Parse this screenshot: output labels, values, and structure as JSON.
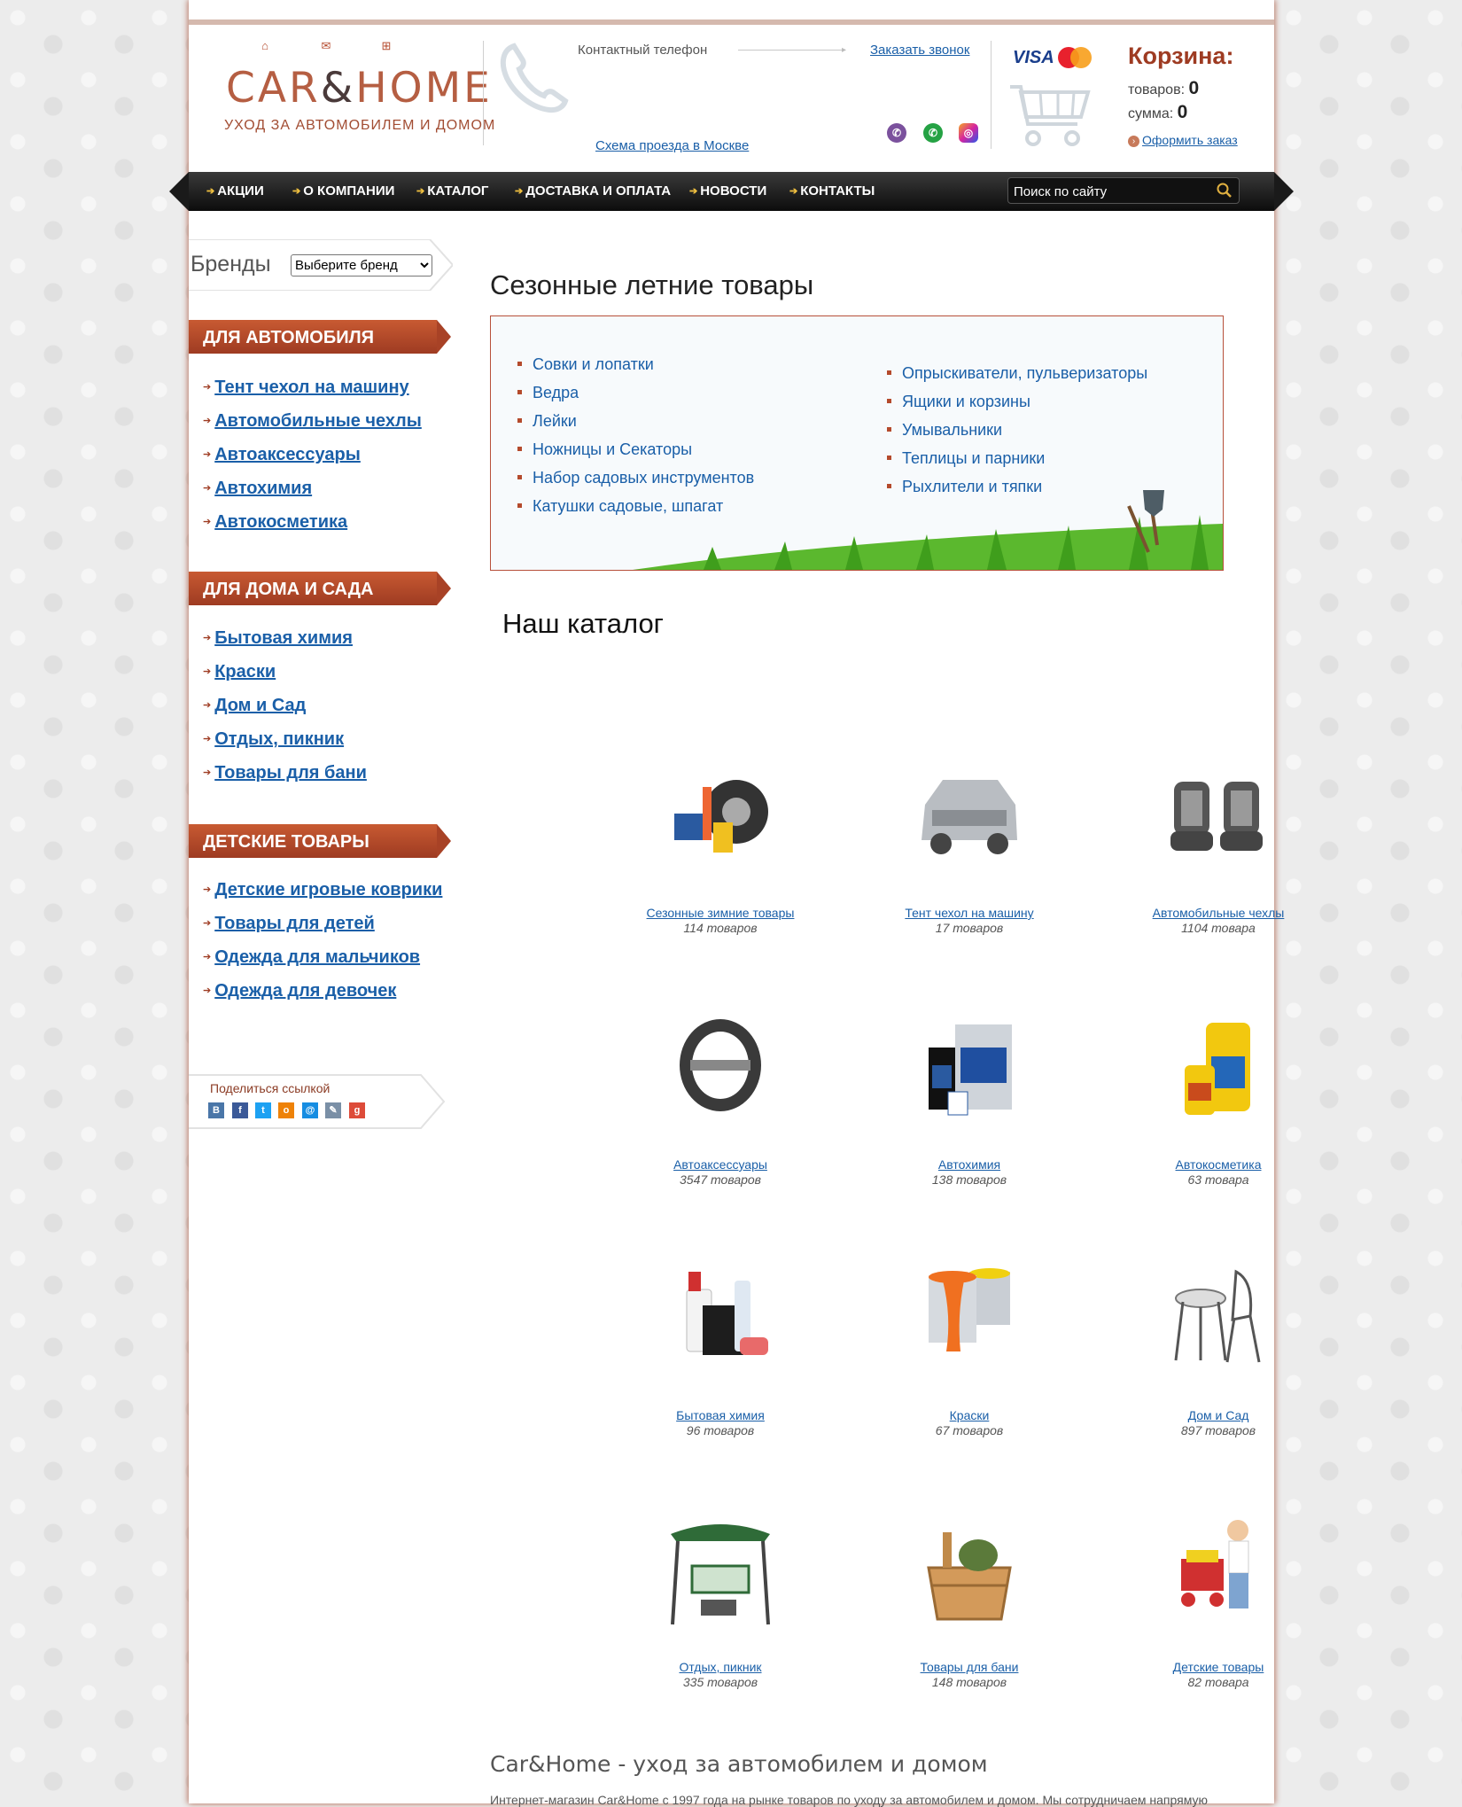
{
  "header": {
    "logo": {
      "part1": "CAR",
      "amp": "&",
      "part2": "HOME",
      "tagline": "УХОД ЗА АВТОМОБИЛЕМ И ДОМОМ"
    },
    "contact_label": "Контактный телефон",
    "callback_link": "Заказать звонок",
    "scheme_link": "Схема проезда в Москве",
    "cards": {
      "visa": "VISA"
    },
    "cart": {
      "title": "Корзина:",
      "items_label": "товаров:",
      "items_value": "0",
      "sum_label": "сумма:",
      "sum_value": "0",
      "order_link": "Оформить заказ"
    }
  },
  "nav": {
    "items": [
      "АКЦИИ",
      "О КОМПАНИИ",
      "КАТАЛОГ",
      "ДОСТАВКА И ОПЛАТА",
      "НОВОСТИ",
      "КОНТАКТЫ"
    ],
    "search_placeholder": "Поиск по сайту"
  },
  "sidebar": {
    "brands_label": "Бренды",
    "brands_select": "Выберите бренд",
    "sections": [
      {
        "title": "ДЛЯ АВТОМОБИЛЯ",
        "items": [
          "Тент чехол на машину",
          "Автомобильные чехлы",
          "Автоаксессуары",
          "Автохимия",
          "Автокосметика"
        ]
      },
      {
        "title": "ДЛЯ ДОМА И САДА",
        "items": [
          "Бытовая химия",
          "Краски",
          "Дом и Сад",
          "Отдых, пикник",
          "Товары для бани"
        ]
      },
      {
        "title": "ДЕТСКИЕ ТОВАРЫ",
        "items": [
          "Детские игровые коврики",
          "Товары для детей",
          "Одежда для мальчиков",
          "Одежда для девочек"
        ]
      }
    ],
    "share_label": "Поделиться ссылкой"
  },
  "seasonal": {
    "title": "Сезонные летние товары",
    "left": [
      "Совки и лопатки",
      "Ведра",
      "Лейки",
      "Ножницы и Секаторы",
      "Набор садовых инструментов",
      "Катушки садовые, шпагат"
    ],
    "right": [
      "Опрыскиватели, пульверизаторы",
      "Ящики и корзины",
      "Умывальники",
      "Теплицы и парники",
      "Рыхлители и тяпки"
    ]
  },
  "catalog": {
    "title": "Наш каталог",
    "items": [
      {
        "name": "Сезонные зимние товары",
        "count": "114 товаров"
      },
      {
        "name": "Тент чехол на машину",
        "count": "17 товаров"
      },
      {
        "name": "Автомобильные чехлы",
        "count": "1104 товара"
      },
      {
        "name": "Автоаксессуары",
        "count": "3547 товаров"
      },
      {
        "name": "Автохимия",
        "count": "138 товаров"
      },
      {
        "name": "Автокосметика",
        "count": "63 товара"
      },
      {
        "name": "Бытовая химия",
        "count": "96 товаров"
      },
      {
        "name": "Краски",
        "count": "67 товаров"
      },
      {
        "name": "Дом и Сад",
        "count": "897 товаров"
      },
      {
        "name": "Отдых, пикник",
        "count": "335 товаров"
      },
      {
        "name": "Товары для бани",
        "count": "148 товаров"
      },
      {
        "name": "Детские товары",
        "count": "82 товара"
      }
    ]
  },
  "footer": {
    "title": "Car&Home - уход за автомобилем и домом",
    "text": "Интернет-магазин Car&Home с 1997 года на рынке товаров по уходу за автомобилем и домом. Мы сотрудничаем напрямую"
  },
  "colors": {
    "accent": "#9e3b22",
    "link": "#1a5fa8",
    "nav_bg": "#111111"
  }
}
